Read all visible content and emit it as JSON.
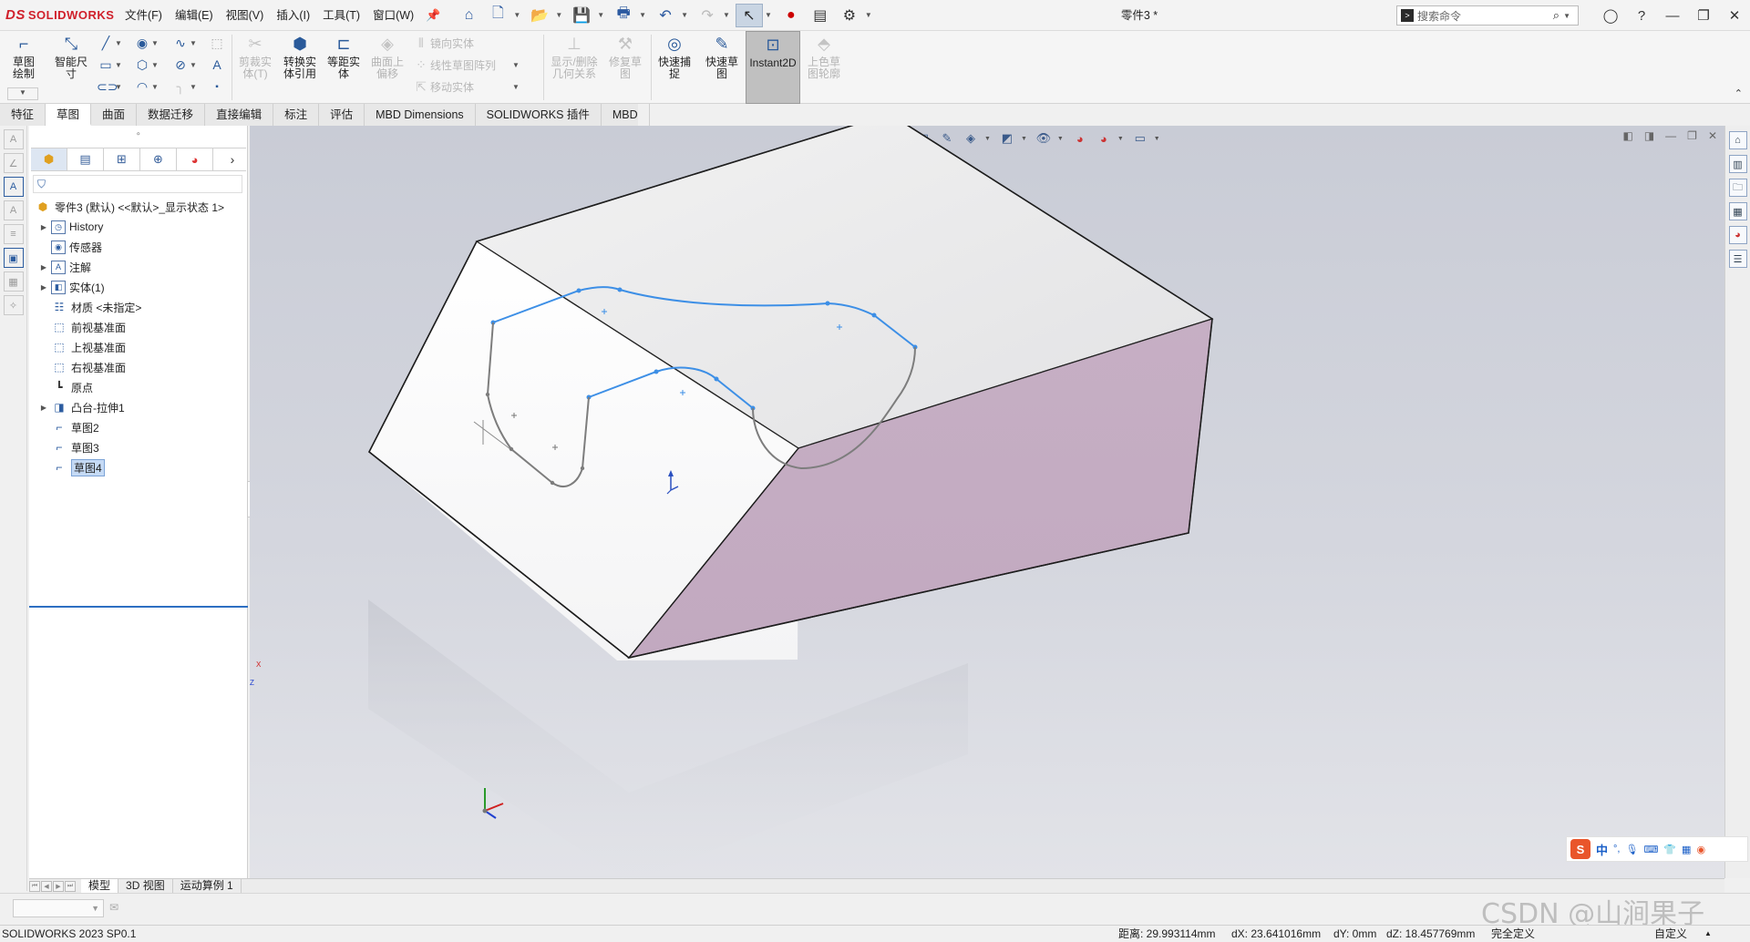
{
  "app": {
    "logo_text": "SOLIDWORKS",
    "logo_mark": "DS",
    "doc_title": "零件3 *",
    "brand_color": "#d0202b"
  },
  "menu": [
    "文件(F)",
    "编辑(E)",
    "视图(V)",
    "插入(I)",
    "工具(T)",
    "窗口(W)"
  ],
  "search": {
    "placeholder": "搜索命令"
  },
  "ribbon": {
    "sketch": "草图绘制",
    "smart_dim": "智能尺寸",
    "trim": "剪裁实体(T)",
    "convert": "转换实体引用",
    "offset": "等距实体",
    "surface_offset": "曲面上偏移",
    "mirror": "镜向实体",
    "linear_pattern": "线性草图阵列",
    "move": "移动实体",
    "display_relations": "显示/删除几何关系",
    "repair": "修复草图",
    "quick_snap": "快速捕捉",
    "rapid_sketch": "快速草图",
    "instant2d": "Instant2D",
    "shaded_sketch": "上色草图轮廓"
  },
  "tabs": [
    "特征",
    "草图",
    "曲面",
    "数据迁移",
    "直接编辑",
    "标注",
    "评估",
    "MBD Dimensions",
    "SOLIDWORKS 插件",
    "MBD"
  ],
  "tree": {
    "root": "零件3 (默认) <<默认>_显示状态 1>",
    "items": [
      "History",
      "传感器",
      "注解",
      "实体(1)",
      "材质 <未指定>",
      "前视基准面",
      "上视基准面",
      "右视基准面",
      "原点",
      "凸台-拉伸1",
      "草图2",
      "草图3",
      "草图4"
    ]
  },
  "bottom_tabs": [
    "模型",
    "3D 视图",
    "运动算例 1"
  ],
  "status": {
    "version": "SOLIDWORKS 2023 SP0.1",
    "distance": "距离: 29.993114mm",
    "dx": "dX: 23.641016mm",
    "dy": "dY: 0mm",
    "dz": "dZ: 18.457769mm",
    "defined": "完全定义",
    "custom": "自定义"
  },
  "ime": {
    "lang": "中"
  },
  "watermark": "CSDN @山涧果子",
  "axis": {
    "x": "X",
    "y": "Y",
    "z": "Z"
  }
}
